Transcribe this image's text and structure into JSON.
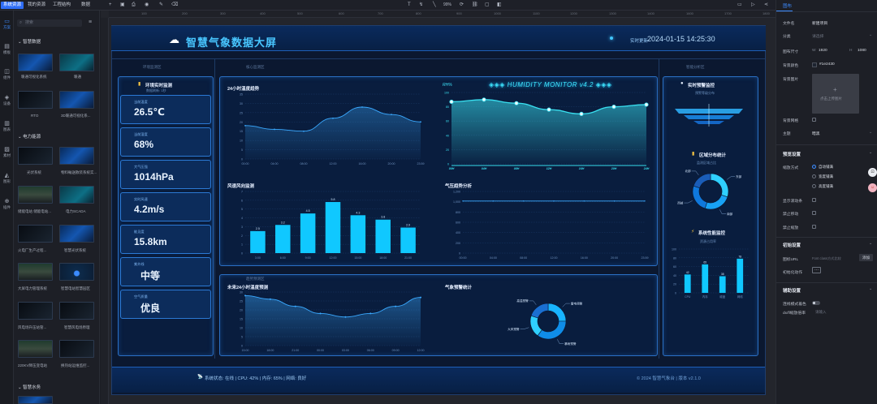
{
  "topbar": {
    "tabs": [
      "系统资源",
      "我的资源",
      "工程结构",
      "数据"
    ],
    "zoom": "99%"
  },
  "iconrail": {
    "items": [
      "方案",
      "模板",
      "组件",
      "设备",
      "图表",
      "素材",
      "图形",
      "插件"
    ]
  },
  "leftpanel": {
    "search_placeholder": "搜索",
    "sections": [
      {
        "title": "智慧数据",
        "items": [
          "暖通可视化系统",
          "暖通",
          "RTO",
          "3D暖通可视化系..."
        ]
      },
      {
        "title": "电力能源",
        "items": [
          "光伏系统",
          "物料輸送散装系统实...",
          "储能电站 储能电站...",
          "电力SCADA",
          "火电厂生产过程...",
          "智慧光伏系统",
          "大屏电力管理系统",
          "智慧电站智慧园区",
          "风电场升压站管...",
          "智慧风电场原理",
          "220KV降压变电站",
          "换热站运维监控..."
        ]
      },
      {
        "title": "智慧水务",
        "items": []
      }
    ]
  },
  "screen": {
    "title": "智慧气象数据大屏",
    "time_label": "实时更新",
    "time_value": "2024-01-15 14:25:30",
    "col_labels": [
      "环境监测区",
      "核心监测区",
      "智能分析区"
    ],
    "center_label": "趋势预测区",
    "env": {
      "title": "环境实时监测",
      "subtitle": "数据刷新: 1秒",
      "cards": [
        {
          "label": "当前温度",
          "value": "26.5℃"
        },
        {
          "label": "当前湿度",
          "value": "68%"
        },
        {
          "label": "大气压强",
          "value": "1014hPa"
        },
        {
          "label": "实时风速",
          "value": "4.2m/s"
        },
        {
          "label": "能见度",
          "value": "15.8km"
        },
        {
          "label": "紫外线",
          "value": "中等"
        },
        {
          "label": "空气质量",
          "value": "优良"
        }
      ]
    },
    "temp_chart": {
      "title": "24小时温度趋势",
      "type": "area",
      "x": [
        "00:00",
        "04:00",
        "08:00",
        "12:00",
        "16:00",
        "20:00",
        "23:59"
      ],
      "y": [
        18,
        16,
        15,
        22,
        28,
        24,
        20
      ],
      "ylim": [
        0,
        35
      ],
      "yticks": [
        0,
        5,
        10,
        15,
        20,
        25,
        30,
        35
      ]
    },
    "humidity_chart": {
      "title": "RH%",
      "banner": "◈◈◈ HUMIDITY MONITOR v4.2 ◈◈◈",
      "type": "area",
      "x": [
        "00H",
        "04H",
        "08H",
        "12H",
        "16H",
        "20H",
        "24H"
      ],
      "y": [
        87,
        90,
        85,
        76,
        70,
        80,
        83
      ],
      "ylim": [
        0,
        100
      ],
      "yticks": [
        0,
        20,
        40,
        60,
        80,
        100
      ]
    },
    "wind_chart": {
      "title": "风速风向监测",
      "type": "bar",
      "categories": [
        "3:00",
        "6:00",
        "9:00",
        "12:00",
        "15:00",
        "18:00",
        "21:00"
      ],
      "values": [
        2.5,
        3.2,
        4.5,
        5.8,
        4.3,
        3.8,
        2.9
      ],
      "ylim": [
        0,
        7
      ],
      "yticks": [
        0,
        1,
        2,
        3,
        4,
        5,
        6,
        7
      ]
    },
    "pressure_chart": {
      "title": "气压趋势分析",
      "type": "line",
      "x": [
        "00:00",
        "04:00",
        "08:00",
        "12:00",
        "16:00",
        "20:00",
        "23:59"
      ],
      "y": [
        1014,
        1014,
        1014,
        1014,
        1014,
        1014,
        1014
      ],
      "ylim": [
        0,
        1200
      ],
      "yticks": [
        0,
        200,
        400,
        600,
        800,
        "1,000",
        "1,200"
      ]
    },
    "forecast_chart": {
      "title": "未来24小时温度预测",
      "type": "area",
      "x": [
        "15:00",
        "18:00",
        "21:00",
        "00:00",
        "03:00",
        "06:00",
        "09:00",
        "12:00"
      ],
      "y": [
        28,
        26,
        22,
        18,
        16,
        18,
        22,
        27
      ],
      "ylim": [
        0,
        30
      ],
      "yticks": [
        0,
        5,
        10,
        15,
        20,
        25,
        30
      ]
    },
    "warning_chart": {
      "title": "气象预警统计",
      "type": "pie",
      "labels": [
        "雷电预警",
        "暴雨预警",
        "大风预警",
        "高温预警"
      ],
      "values": [
        25,
        35,
        20,
        20
      ]
    },
    "alert": {
      "title": "实时预警监控",
      "subtitle": "预警等级分布"
    },
    "region": {
      "title": "区域分布统计",
      "subtitle": "监测区域占比",
      "labels": [
        "东部",
        "南部",
        "西部",
        "北部"
      ],
      "values": [
        30,
        25,
        25,
        20
      ]
    },
    "perf": {
      "title": "系统性能监控",
      "subtitle": "资源占用率",
      "type": "bar",
      "categories": [
        "CPU",
        "内存",
        "磁盘",
        "网络"
      ],
      "values": [
        42,
        65,
        38,
        78
      ],
      "ylim": [
        0,
        100
      ],
      "yticks": [
        0,
        20,
        40,
        60,
        80,
        100
      ]
    },
    "footer_status": "系统状态: 在线 | CPU: 42% | 内存: 65% | 网络: 良好",
    "footer_copy": "© 2024 智慧气象台 | 版本 v2.1.0"
  },
  "rightpanel": {
    "tab": "图布",
    "file_name_label": "文件名",
    "file_name": "新建项目",
    "category_label": "分类",
    "category_placeholder": "请选择",
    "size_label": "图布尺寸",
    "width_label": "W",
    "width": "1920",
    "height_label": "H",
    "height": "1080",
    "bg_color_label": "背景颜色",
    "bg_color": "#1e2430",
    "bg_image_label": "背景图片",
    "bg_image_hint": "点击上传图片",
    "grid_label": "背景网格",
    "theme_label": "主题",
    "theme_value": "暗黑",
    "preview_section": "预览设置",
    "zoom_mode_label": "缩放方式",
    "zoom_modes": [
      "自动铺满",
      "宽度铺满",
      "高度铺满"
    ],
    "show_scroll_label": "显示滚动条",
    "no_move_label": "禁止移动",
    "no_zoom_label": "禁止缩放",
    "init_section": "初始设置",
    "icon_url_label": "图标URL",
    "icon_url_placeholder": "Font class方式比较",
    "icon_url_button": "添加",
    "init_action_label": "初始化动作",
    "aux_section": "辅助设置",
    "snap_label": "连线模式着色",
    "dx_label": "dx/fl缩放倍率",
    "dx_placeholder": "请输入"
  }
}
